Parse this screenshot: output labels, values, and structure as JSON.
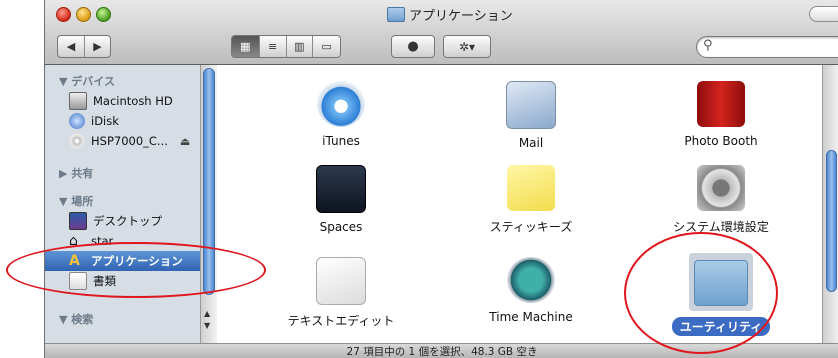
{
  "window": {
    "title": "アプリケーション"
  },
  "toolbar": {
    "back": "◀",
    "forward": "▶",
    "views": [
      "▦",
      "≡",
      "▥",
      "▭"
    ],
    "quicklook": "●",
    "action": "✲▾",
    "search_placeholder": ""
  },
  "sidebar": {
    "sections": {
      "devices": "▼ デバイス",
      "shared": "▶ 共有",
      "places": "▼ 場所",
      "search": "▼ 検索"
    },
    "devices": [
      "Macintosh HD",
      "iDisk",
      "HSP7000_C..."
    ],
    "eject": "⏏",
    "places": [
      "デスクトップ",
      "star",
      "アプリケーション",
      "書類"
    ]
  },
  "apps": [
    {
      "name": "iTunes",
      "icon": "itunes-icon"
    },
    {
      "name": "Mail",
      "icon": "mail-icon"
    },
    {
      "name": "Photo Booth",
      "icon": "photo-booth-icon"
    },
    {
      "name": "Spaces",
      "icon": "spaces-icon"
    },
    {
      "name": "スティッキーズ",
      "icon": "stickies-icon"
    },
    {
      "name": "システム環境設定",
      "icon": "system-preferences-icon"
    },
    {
      "name": "テキストエディット",
      "icon": "textedit-icon"
    },
    {
      "name": "Time Machine",
      "icon": "time-machine-icon"
    },
    {
      "name": "ユーティリティ",
      "icon": "utilities-folder-icon",
      "selected": true
    }
  ],
  "status": "27 項目中の 1 個を選択、48.3 GB 空き",
  "colors": {
    "selection": "#3b6bc2",
    "annotation": "#e0161d",
    "sidebar": "#d6dde5"
  }
}
